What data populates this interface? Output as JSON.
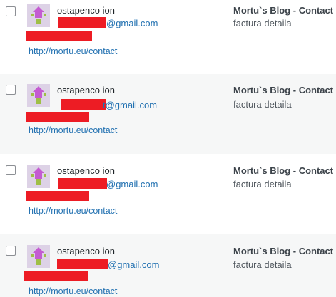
{
  "rows": [
    {
      "author": "ostapenco ion",
      "email": "@gmail.com",
      "url": "http://mortu.eu/contact",
      "post_title": "Mortu`s Blog - Contact",
      "post_sub": "factura detaila"
    },
    {
      "author": "ostapenco ion",
      "email": "t@gmail.com",
      "url": "http://mortu.eu/contact",
      "post_title": "Mortu`s Blog - Contact",
      "post_sub": "factura detaila"
    },
    {
      "author": "ostapenco ion",
      "email": "@gmail.com",
      "url": "http://mortu.eu/contact",
      "post_title": "Mortu`s Blog - Contact",
      "post_sub": "factura detaila"
    },
    {
      "author": "ostapenco ion",
      "email": "@gmail.com",
      "url": "http://mortu.eu/contact",
      "post_title": "Mortu`s Blog - Contact",
      "post_sub": "factura detaila"
    }
  ],
  "colors": {
    "link": "#2271b1",
    "redaction": "#ed1c24",
    "alt_row": "#f6f7f7"
  },
  "icons": {
    "avatar": "identicon-avatar-icon"
  }
}
